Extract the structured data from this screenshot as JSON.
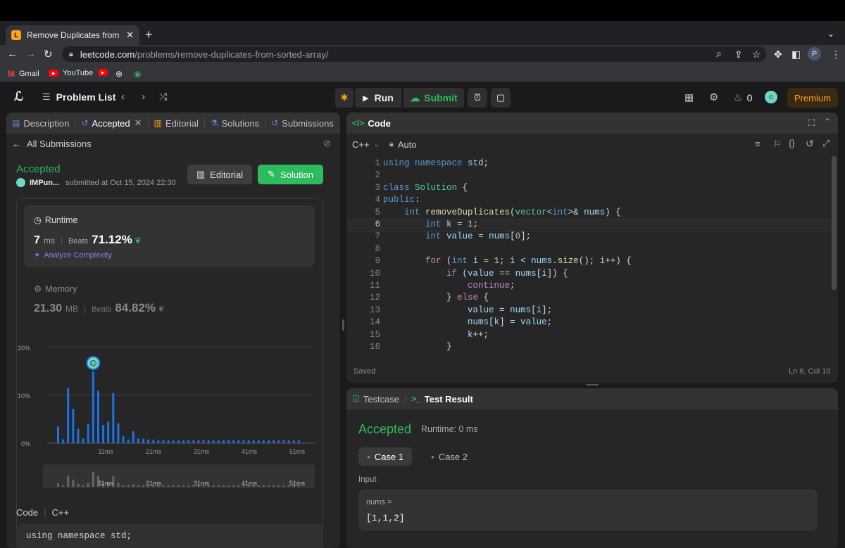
{
  "browser": {
    "tab_title": "Remove Duplicates from Sorte",
    "tab_close": "✕",
    "new_tab": "+",
    "url_host": "leetcode.com",
    "url_path": "/problems/remove-duplicates-from-sorted-array/",
    "bookmarks": [
      "Gmail",
      "YouTube"
    ],
    "profile_initial": "P"
  },
  "header": {
    "problem_list": "Problem List",
    "run": "Run",
    "submit": "Submit",
    "streak": "0",
    "premium": "Premium"
  },
  "left_tabs": [
    {
      "label": "Description",
      "icon": "document-icon"
    },
    {
      "label": "Accepted",
      "icon": "history-icon",
      "active": true
    },
    {
      "label": "Editorial",
      "icon": "book-icon"
    },
    {
      "label": "Solutions",
      "icon": "flask-icon"
    },
    {
      "label": "Submissions",
      "icon": "clock-icon"
    }
  ],
  "submission": {
    "back_label": "All Submissions",
    "status": "Accepted",
    "user": "IMPun...",
    "submitted_at": "submitted at Oct 15, 2024 22:30",
    "editorial_btn": "Editorial",
    "solution_btn": "Solution",
    "runtime_label": "Runtime",
    "runtime_value": "7",
    "runtime_unit": "ms",
    "beats_label": "Beats",
    "runtime_beats": "71.12%",
    "analyze": "Analyze Complexity",
    "memory_label": "Memory",
    "memory_value": "21.30",
    "memory_unit": "MB",
    "memory_beats": "84.82%",
    "code_label": "Code",
    "code_lang": "C++",
    "code_preview": "using namespace std;"
  },
  "chart_data": {
    "type": "bar",
    "y_ticks": [
      "20%",
      "10%",
      "0%"
    ],
    "x_ticks": [
      "11ms",
      "21ms",
      "31ms",
      "41ms",
      "51ms"
    ],
    "values": [
      3.5,
      0.8,
      11.5,
      7.2,
      3.0,
      1.0,
      4.0,
      15.0,
      11.0,
      3.8,
      4.5,
      10.5,
      4.2,
      1.5,
      0.8,
      2.5,
      1.0,
      1.0,
      0.8,
      0.7,
      0.6,
      0.6,
      0.6,
      0.6,
      0.6,
      0.6,
      0.6,
      0.6,
      0.6,
      0.6,
      0.6,
      0.6,
      0.6,
      0.6,
      0.6,
      0.6,
      0.6,
      0.6,
      0.6,
      0.6,
      0.6,
      0.6,
      0.6,
      0.6,
      0.6,
      0.6,
      0.6,
      0.6,
      0.6
    ],
    "ylim": [
      0,
      20
    ],
    "highlight_index": 7,
    "bar_color": "#1a73e8",
    "grid": true
  },
  "editor": {
    "title": "Code",
    "lang": "C++",
    "mode": "Auto",
    "status": "Saved",
    "cursor": "Ln 6, Col 10",
    "lines": [
      "using namespace std;",
      "",
      "class Solution {",
      "public:",
      "    int removeDuplicates(vector<int>& nums) {",
      "        int k = 1;",
      "        int value = nums[0];",
      "",
      "        for (int i = 1; i < nums.size(); i++) {",
      "            if (value == nums[i]) {",
      "                continue;",
      "            } else {",
      "                value = nums[i];",
      "                nums[k] = value;",
      "                k++;",
      "            }"
    ]
  },
  "tests": {
    "testcase_tab": "Testcase",
    "result_tab": "Test Result",
    "status": "Accepted",
    "runtime": "Runtime: 0 ms",
    "cases": [
      "Case 1",
      "Case 2"
    ],
    "input_label": "Input",
    "var_name": "nums =",
    "var_value": "[1,1,2]"
  }
}
